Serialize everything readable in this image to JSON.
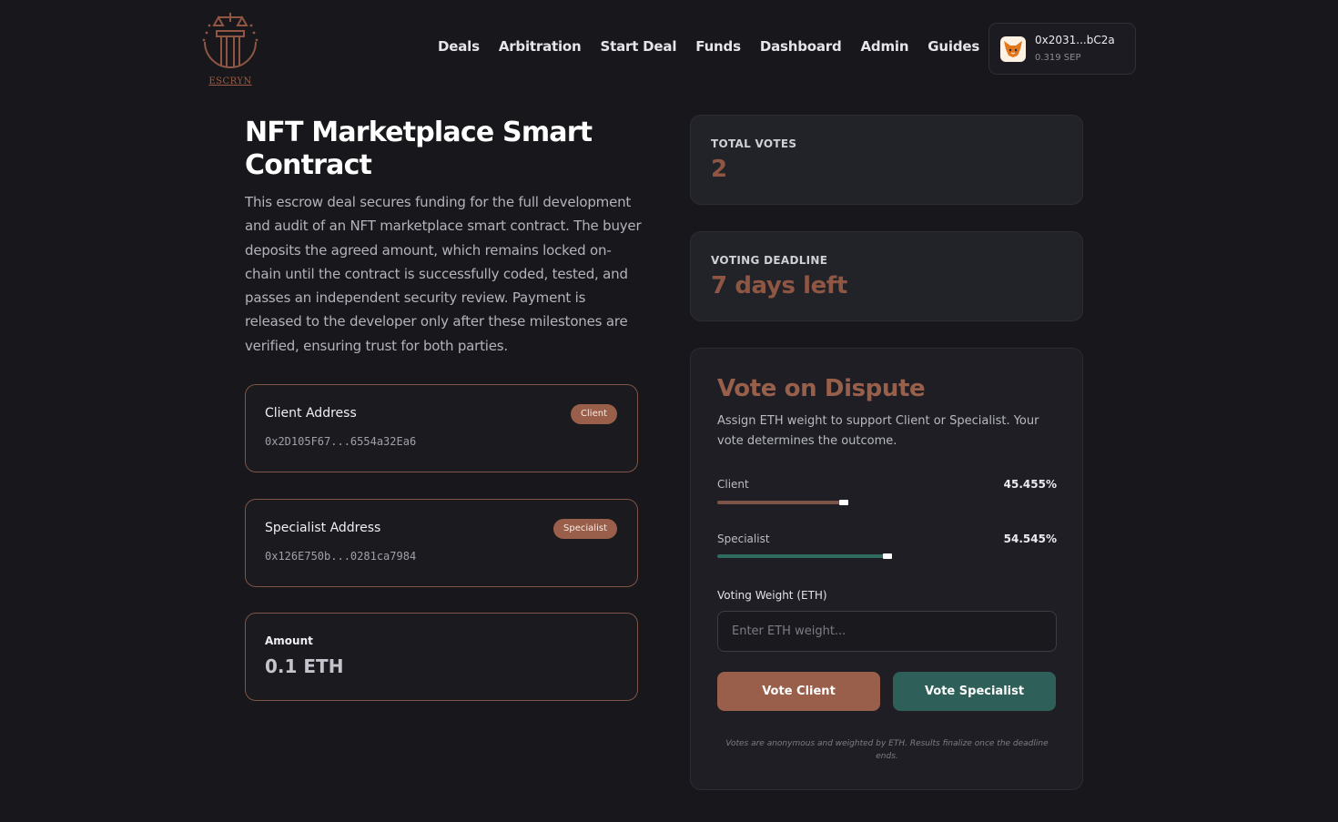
{
  "header": {
    "logo_text": "ESCRYN",
    "nav": [
      "Deals",
      "Arbitration",
      "Start Deal",
      "Funds",
      "Dashboard",
      "Admin",
      "Guides"
    ],
    "wallet": {
      "address": "0x2031...bC2a",
      "balance": "0.319 SEP"
    }
  },
  "deal": {
    "title": "NFT Marketplace Smart Contract",
    "description": "This escrow deal secures funding for the full development and audit of an NFT marketplace smart contract. The buyer deposits the agreed amount, which remains locked on-chain until the contract is successfully coded, tested, and passes an independent security review. Payment is released to the developer only after these milestones are verified, ensuring trust for both parties.",
    "client": {
      "label": "Client Address",
      "badge": "Client",
      "address": "0x2D105F67...6554a32Ea6"
    },
    "specialist": {
      "label": "Specialist Address",
      "badge": "Specialist",
      "address": "0x126E750b...0281ca7984"
    },
    "amount": {
      "label": "Amount",
      "value": "0.1 ETH"
    }
  },
  "stats": {
    "total_votes": {
      "label": "TOTAL VOTES",
      "value": "2"
    },
    "deadline": {
      "label": "VOTING DEADLINE",
      "value": "7 days left"
    }
  },
  "vote": {
    "title": "Vote on Dispute",
    "description": "Assign ETH weight to support Client or Specialist. Your vote determines the outcome.",
    "client": {
      "label": "Client",
      "percent_text": "45.455%",
      "fraction": 0.45455,
      "color": "#7a5446"
    },
    "specialist": {
      "label": "Specialist",
      "percent_text": "54.545%",
      "fraction": 0.54545,
      "color": "#2f6b60"
    },
    "weight_label": "Voting Weight (ETH)",
    "weight_placeholder": "Enter ETH weight...",
    "vote_client_label": "Vote Client",
    "vote_specialist_label": "Vote Specialist",
    "note": "Votes are anonymous and weighted by ETH. Results finalize once the deadline ends."
  }
}
